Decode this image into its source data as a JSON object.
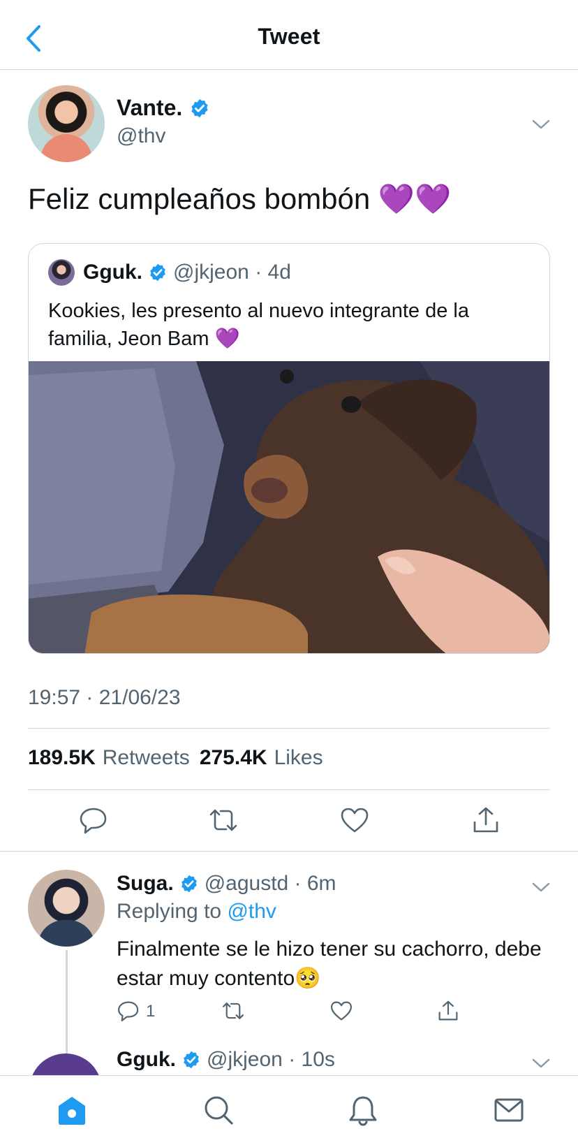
{
  "header": {
    "title": "Tweet"
  },
  "main_tweet": {
    "name": "Vante.",
    "handle": "@thv",
    "text": "Feliz cumpleaños bombón 💜💜",
    "timestamp": "19:57 · 21/06/23",
    "stats": {
      "retweets_count": "189.5K",
      "retweets_label": "Retweets",
      "likes_count": "275.4K",
      "likes_label": "Likes"
    }
  },
  "quoted_tweet": {
    "name": "Gguk.",
    "meta": "@jkjeon · 4d",
    "text": "Kookies, les presento al nuevo integrante de la familia, Jeon Bam 💜"
  },
  "reply": {
    "name": "Suga.",
    "meta": "@agustd · 6m",
    "replying_prefix": "Replying to ",
    "replying_mention": "@thv",
    "text": "Finalmente se le hizo tener su cachorro, debe estar muy contento🥺",
    "reply_count": "1"
  },
  "next_reply": {
    "name": "Gguk.",
    "meta": "@jkjeon · 10s"
  },
  "colors": {
    "accent": "#1d9bf0",
    "secondary_text": "#536471",
    "divider": "#cfd9de",
    "verified": "#1d9bf0"
  },
  "icons": {
    "back": "chevron-left-icon",
    "verified": "verified-badge-icon",
    "more": "chevron-down-icon",
    "reply": "comment-icon",
    "retweet": "retweet-icon",
    "like": "heart-icon",
    "share": "share-icon",
    "tab_home": "home-icon",
    "tab_search": "search-icon",
    "tab_notifications": "bell-icon",
    "tab_messages": "mail-icon"
  }
}
